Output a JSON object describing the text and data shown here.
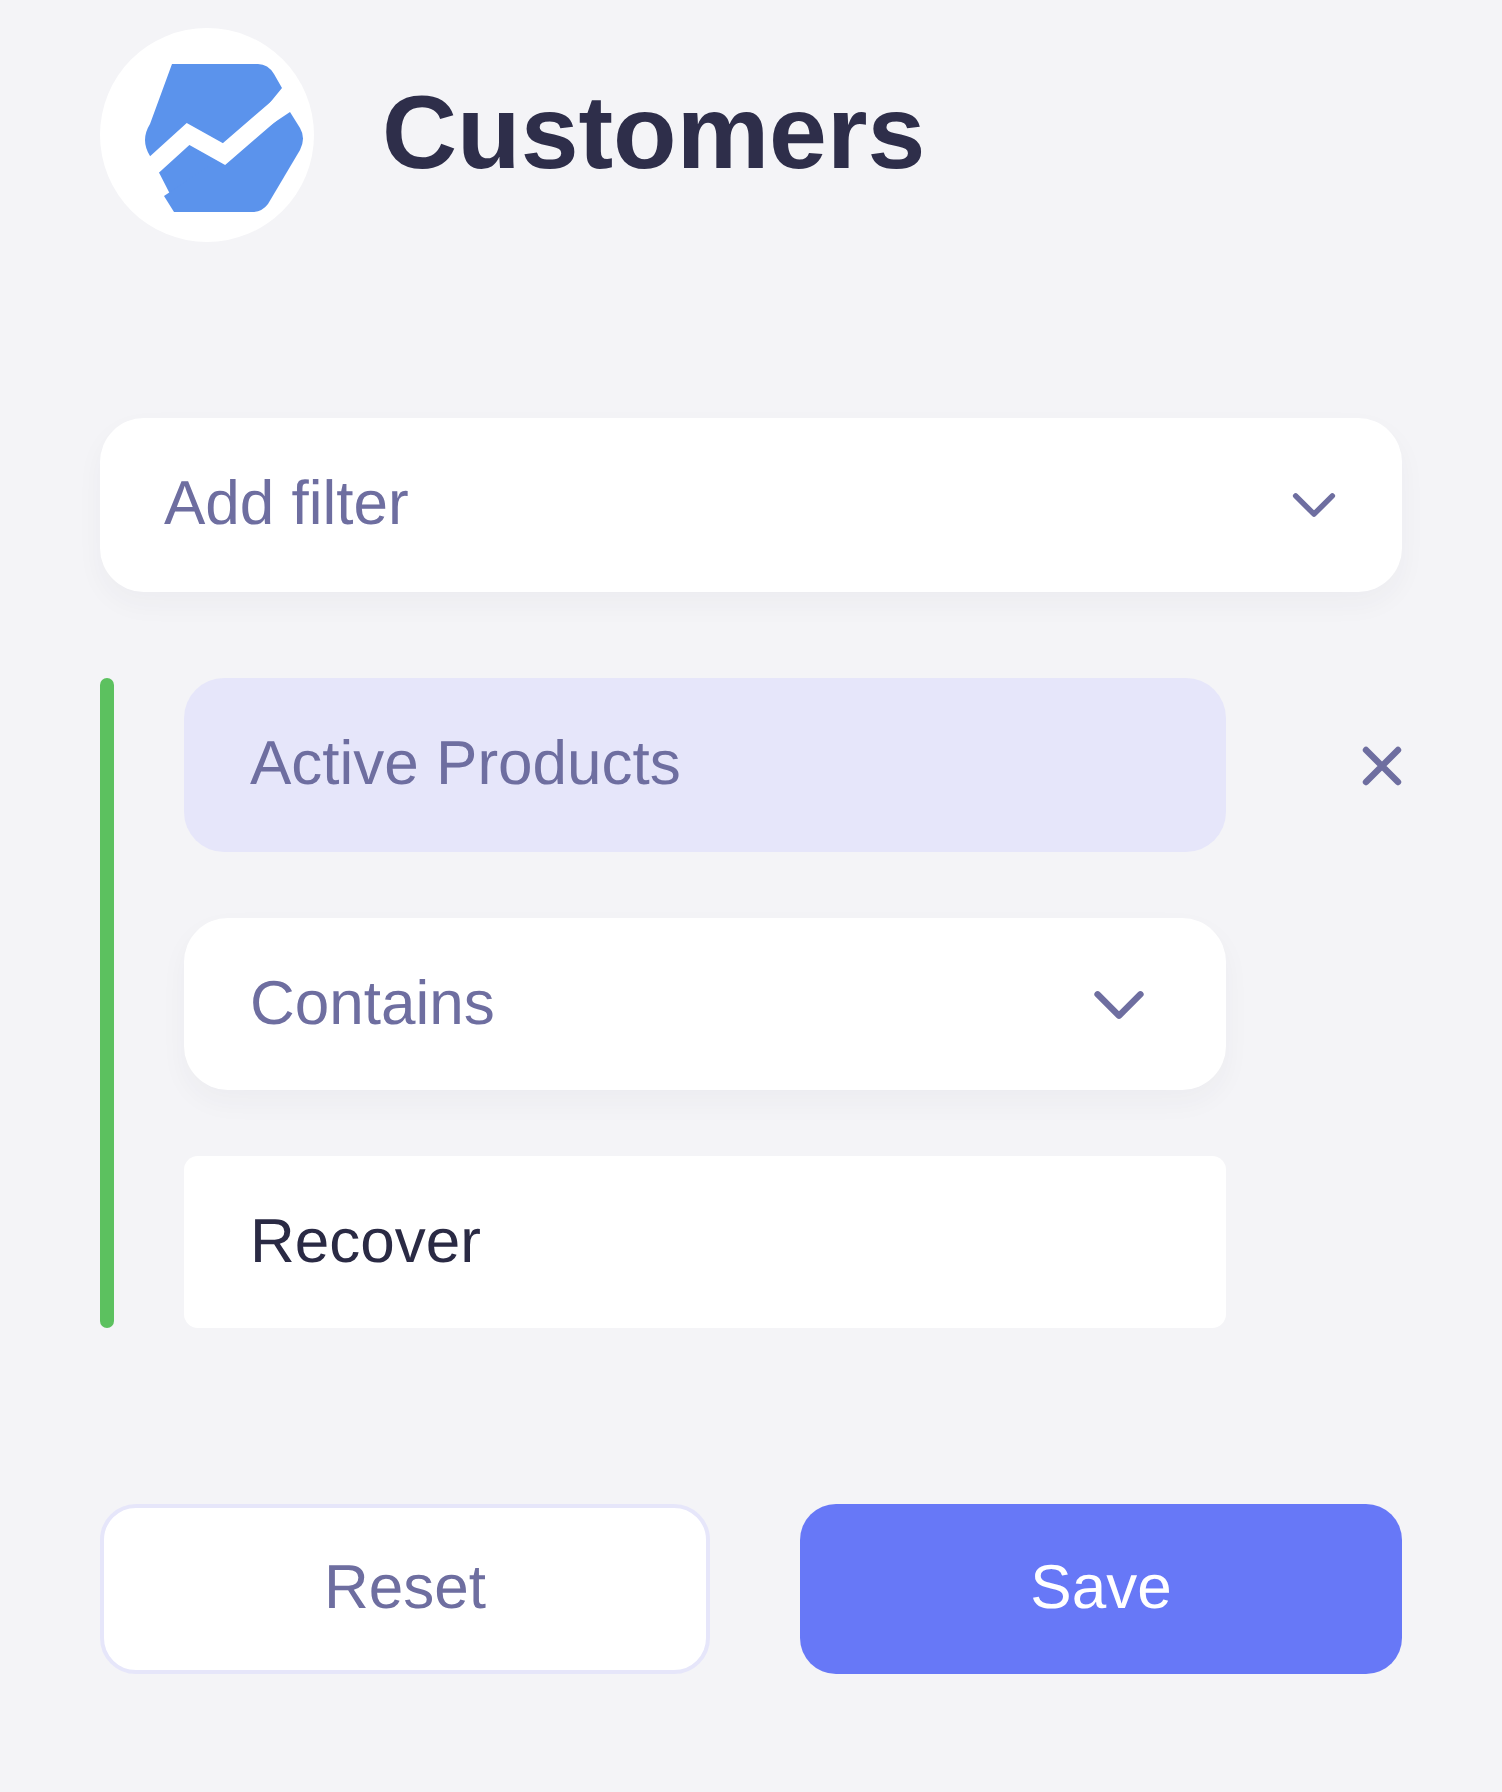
{
  "header": {
    "title": "Customers"
  },
  "add_filter": {
    "label": "Add filter"
  },
  "filters": [
    {
      "field": "Active Products",
      "operator": "Contains",
      "value": "Recover"
    }
  ],
  "buttons": [
    {
      "label": "Reset",
      "kind": "secondary"
    },
    {
      "label": "Save",
      "kind": "primary"
    }
  ]
}
